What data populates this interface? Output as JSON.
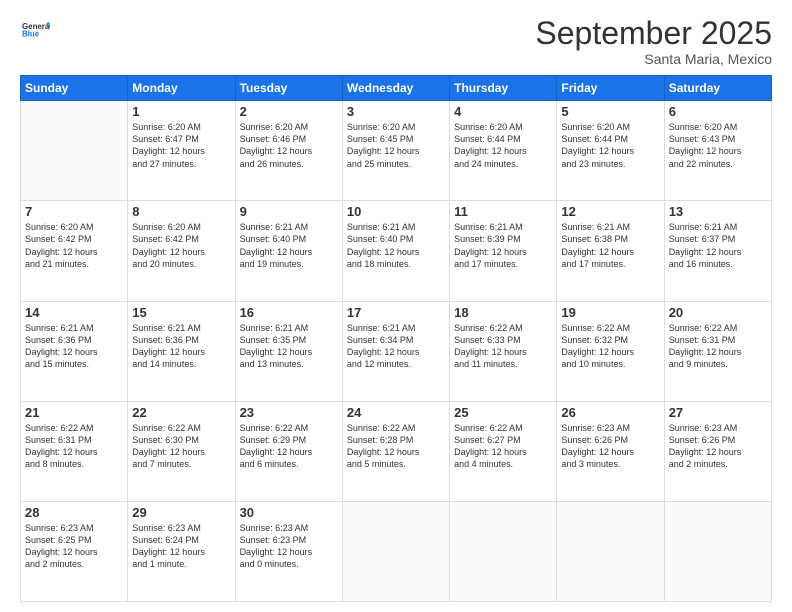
{
  "header": {
    "logo_line1": "General",
    "logo_line2": "Blue",
    "month": "September 2025",
    "location": "Santa Maria, Mexico"
  },
  "weekdays": [
    "Sunday",
    "Monday",
    "Tuesday",
    "Wednesday",
    "Thursday",
    "Friday",
    "Saturday"
  ],
  "weeks": [
    [
      {
        "day": "",
        "info": ""
      },
      {
        "day": "1",
        "info": "Sunrise: 6:20 AM\nSunset: 6:47 PM\nDaylight: 12 hours\nand 27 minutes."
      },
      {
        "day": "2",
        "info": "Sunrise: 6:20 AM\nSunset: 6:46 PM\nDaylight: 12 hours\nand 26 minutes."
      },
      {
        "day": "3",
        "info": "Sunrise: 6:20 AM\nSunset: 6:45 PM\nDaylight: 12 hours\nand 25 minutes."
      },
      {
        "day": "4",
        "info": "Sunrise: 6:20 AM\nSunset: 6:44 PM\nDaylight: 12 hours\nand 24 minutes."
      },
      {
        "day": "5",
        "info": "Sunrise: 6:20 AM\nSunset: 6:44 PM\nDaylight: 12 hours\nand 23 minutes."
      },
      {
        "day": "6",
        "info": "Sunrise: 6:20 AM\nSunset: 6:43 PM\nDaylight: 12 hours\nand 22 minutes."
      }
    ],
    [
      {
        "day": "7",
        "info": ""
      },
      {
        "day": "8",
        "info": "Sunrise: 6:20 AM\nSunset: 6:42 PM\nDaylight: 12 hours\nand 20 minutes."
      },
      {
        "day": "9",
        "info": "Sunrise: 6:21 AM\nSunset: 6:40 PM\nDaylight: 12 hours\nand 19 minutes."
      },
      {
        "day": "10",
        "info": "Sunrise: 6:21 AM\nSunset: 6:40 PM\nDaylight: 12 hours\nand 18 minutes."
      },
      {
        "day": "11",
        "info": "Sunrise: 6:21 AM\nSunset: 6:39 PM\nDaylight: 12 hours\nand 17 minutes."
      },
      {
        "day": "12",
        "info": "Sunrise: 6:21 AM\nSunset: 6:38 PM\nDaylight: 12 hours\nand 17 minutes."
      },
      {
        "day": "13",
        "info": "Sunrise: 6:21 AM\nSunset: 6:37 PM\nDaylight: 12 hours\nand 16 minutes."
      }
    ],
    [
      {
        "day": "14",
        "info": ""
      },
      {
        "day": "15",
        "info": "Sunrise: 6:21 AM\nSunset: 6:36 PM\nDaylight: 12 hours\nand 14 minutes."
      },
      {
        "day": "16",
        "info": "Sunrise: 6:21 AM\nSunset: 6:35 PM\nDaylight: 12 hours\nand 13 minutes."
      },
      {
        "day": "17",
        "info": "Sunrise: 6:21 AM\nSunset: 6:34 PM\nDaylight: 12 hours\nand 12 minutes."
      },
      {
        "day": "18",
        "info": "Sunrise: 6:22 AM\nSunset: 6:33 PM\nDaylight: 12 hours\nand 11 minutes."
      },
      {
        "day": "19",
        "info": "Sunrise: 6:22 AM\nSunset: 6:32 PM\nDaylight: 12 hours\nand 10 minutes."
      },
      {
        "day": "20",
        "info": "Sunrise: 6:22 AM\nSunset: 6:31 PM\nDaylight: 12 hours\nand 9 minutes."
      }
    ],
    [
      {
        "day": "21",
        "info": ""
      },
      {
        "day": "22",
        "info": "Sunrise: 6:22 AM\nSunset: 6:30 PM\nDaylight: 12 hours\nand 7 minutes."
      },
      {
        "day": "23",
        "info": "Sunrise: 6:22 AM\nSunset: 6:29 PM\nDaylight: 12 hours\nand 6 minutes."
      },
      {
        "day": "24",
        "info": "Sunrise: 6:22 AM\nSunset: 6:28 PM\nDaylight: 12 hours\nand 5 minutes."
      },
      {
        "day": "25",
        "info": "Sunrise: 6:22 AM\nSunset: 6:27 PM\nDaylight: 12 hours\nand 4 minutes."
      },
      {
        "day": "26",
        "info": "Sunrise: 6:23 AM\nSunset: 6:26 PM\nDaylight: 12 hours\nand 3 minutes."
      },
      {
        "day": "27",
        "info": "Sunrise: 6:23 AM\nSunset: 6:26 PM\nDaylight: 12 hours\nand 2 minutes."
      }
    ],
    [
      {
        "day": "28",
        "info": "Sunrise: 6:23 AM\nSunset: 6:25 PM\nDaylight: 12 hours\nand 2 minutes."
      },
      {
        "day": "29",
        "info": "Sunrise: 6:23 AM\nSunset: 6:24 PM\nDaylight: 12 hours\nand 1 minute."
      },
      {
        "day": "30",
        "info": "Sunrise: 6:23 AM\nSunset: 6:23 PM\nDaylight: 12 hours\nand 0 minutes."
      },
      {
        "day": "",
        "info": ""
      },
      {
        "day": "",
        "info": ""
      },
      {
        "day": "",
        "info": ""
      },
      {
        "day": "",
        "info": ""
      }
    ]
  ],
  "week1_day7_info": "Sunrise: 6:20 AM\nSunset: 6:42 PM\nDaylight: 12 hours\nand 21 minutes.",
  "week2_day14_info": "Sunrise: 6:21 AM\nSunset: 6:36 PM\nDaylight: 12 hours\nand 15 minutes.",
  "week3_day21_info": "Sunrise: 6:22 AM\nSunset: 6:31 PM\nDaylight: 12 hours\nand 8 minutes."
}
